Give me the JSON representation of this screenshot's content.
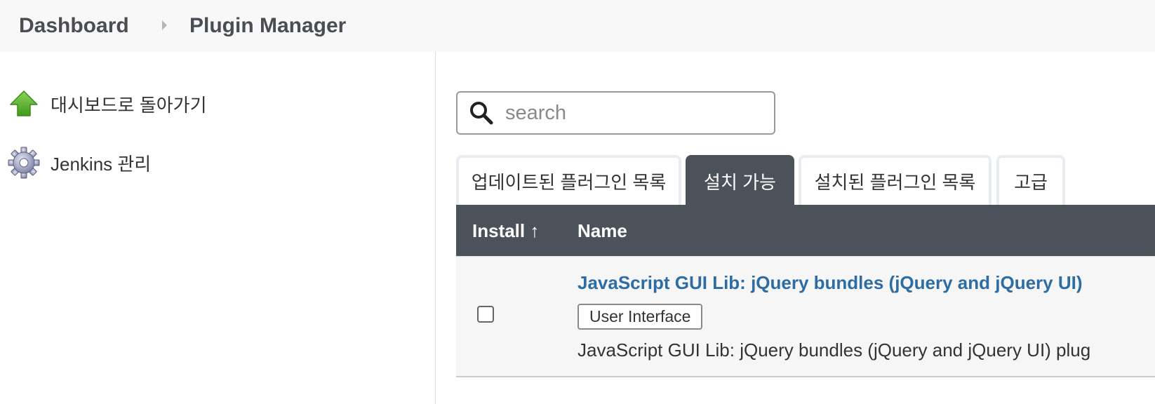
{
  "breadcrumb": {
    "items": [
      "Dashboard",
      "Plugin Manager"
    ]
  },
  "sidebar": {
    "items": [
      {
        "label": "대시보드로 돌아가기",
        "icon": "up-arrow-icon"
      },
      {
        "label": "Jenkins 관리",
        "icon": "gear-icon"
      }
    ]
  },
  "search": {
    "placeholder": "search",
    "value": ""
  },
  "tabs": [
    {
      "label": "업데이트된 플러그인 목록",
      "active": false
    },
    {
      "label": "설치 가능",
      "active": true
    },
    {
      "label": "설치된 플러그인 목록",
      "active": false
    },
    {
      "label": "고급",
      "active": false
    }
  ],
  "table": {
    "columns": [
      "Install ↑",
      "Name"
    ],
    "rows": [
      {
        "checked": false,
        "name": "JavaScript GUI Lib: jQuery bundles (jQuery and jQuery UI)",
        "category": "User Interface",
        "description": "JavaScript GUI Lib: jQuery bundles (jQuery and jQuery UI) plug"
      }
    ]
  },
  "colors": {
    "header_bg": "#4c5259",
    "link": "#2e6da4",
    "breadcrumb_bg": "#f8f8f8",
    "row_bg": "#f6f6f6"
  }
}
